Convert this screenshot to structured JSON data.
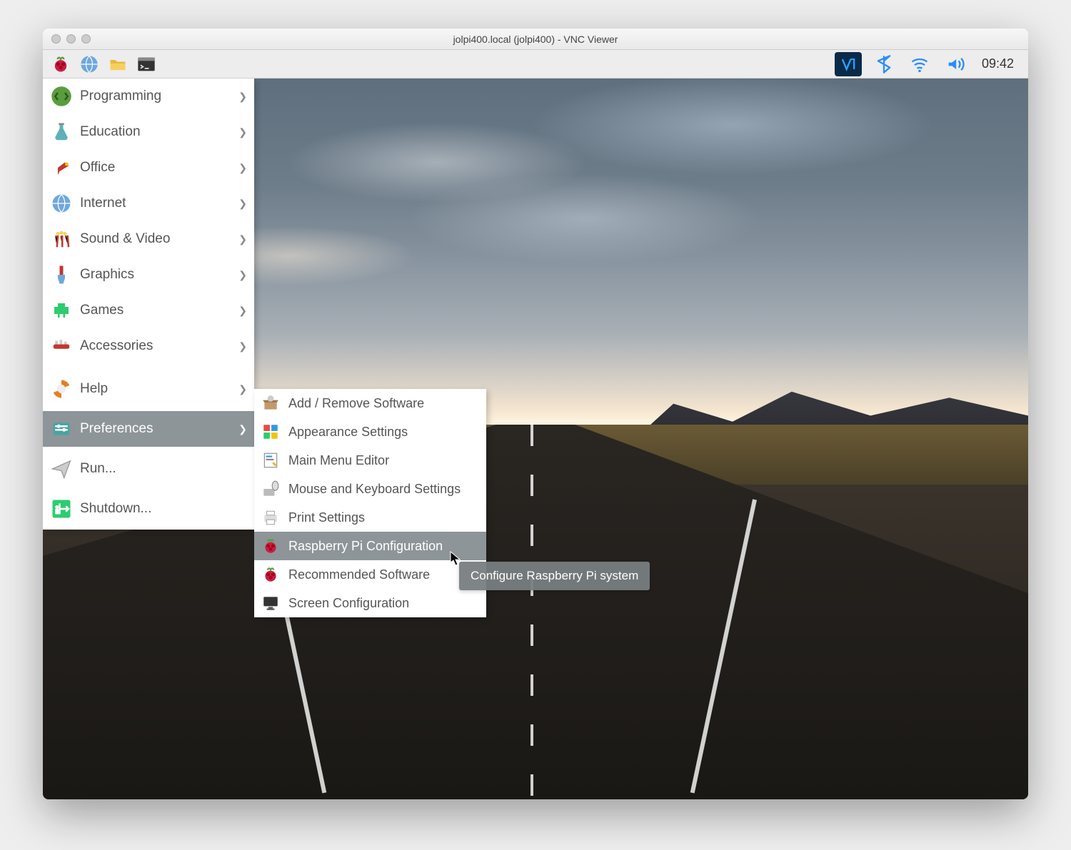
{
  "mac_title": "jolpi400.local (jolpi400) - VNC Viewer",
  "taskbar": {
    "clock": "09:42"
  },
  "menu": {
    "items": [
      {
        "label": "Programming",
        "icon": "code-icon",
        "sub": true
      },
      {
        "label": "Education",
        "icon": "flask-icon",
        "sub": true
      },
      {
        "label": "Office",
        "icon": "lamp-icon",
        "sub": true
      },
      {
        "label": "Internet",
        "icon": "globe-icon",
        "sub": true
      },
      {
        "label": "Sound & Video",
        "icon": "popcorn-icon",
        "sub": true
      },
      {
        "label": "Graphics",
        "icon": "brush-icon",
        "sub": true
      },
      {
        "label": "Games",
        "icon": "invader-icon",
        "sub": true
      },
      {
        "label": "Accessories",
        "icon": "knife-icon",
        "sub": true
      },
      {
        "label": "Help",
        "icon": "lifebuoy-icon",
        "sub": true
      },
      {
        "label": "Preferences",
        "icon": "sliders-icon",
        "sub": true,
        "active": true
      },
      {
        "label": "Run...",
        "icon": "paperplane-icon",
        "sub": false
      },
      {
        "label": "Shutdown...",
        "icon": "exit-icon",
        "sub": false
      }
    ]
  },
  "submenu": {
    "items": [
      {
        "label": "Add / Remove Software",
        "icon": "box-icon"
      },
      {
        "label": "Appearance Settings",
        "icon": "palette-icon"
      },
      {
        "label": "Main Menu Editor",
        "icon": "editor-icon"
      },
      {
        "label": "Mouse and Keyboard Settings",
        "icon": "mouse-icon"
      },
      {
        "label": "Print Settings",
        "icon": "printer-icon"
      },
      {
        "label": "Raspberry Pi Configuration",
        "icon": "raspberry-icon",
        "active": true
      },
      {
        "label": "Recommended Software",
        "icon": "raspberry-icon"
      },
      {
        "label": "Screen Configuration",
        "icon": "monitor-icon"
      }
    ]
  },
  "tooltip": "Configure Raspberry Pi system"
}
